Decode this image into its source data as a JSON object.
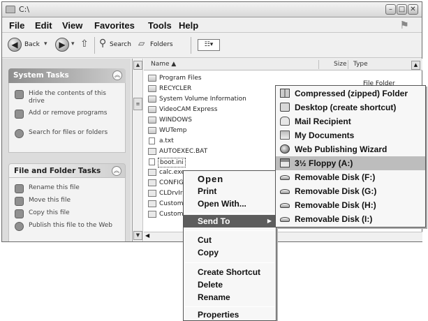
{
  "window": {
    "title": "C:\\",
    "minimize": "–",
    "maximize": "□",
    "close": "✕"
  },
  "menubar": [
    "File",
    "Edit",
    "View",
    "Favorites",
    "Tools",
    "Help"
  ],
  "toolbar": {
    "back": "Back",
    "search": "Search",
    "folders": "Folders",
    "views_glyph": "☷▾"
  },
  "tasks": {
    "system_title": "System Tasks",
    "system_items": [
      "Hide the contents of this drive",
      "Add or remove programs",
      "Search for files or folders"
    ],
    "file_title": "File and Folder Tasks",
    "file_items": [
      "Rename this file",
      "Move this file",
      "Copy this file",
      "Publish this file to the Web"
    ]
  },
  "columns": {
    "name": "Name ▲",
    "size": "Size",
    "type": "Type"
  },
  "files": [
    {
      "name": "Program Files",
      "kind": "folder"
    },
    {
      "name": "RECYCLER",
      "kind": "folder"
    },
    {
      "name": "System Volume Information",
      "kind": "folder"
    },
    {
      "name": "VideoCAM Express",
      "kind": "folder"
    },
    {
      "name": "WINDOWS",
      "kind": "folder"
    },
    {
      "name": "WUTemp",
      "kind": "folder"
    },
    {
      "name": "a.txt",
      "kind": "doc"
    },
    {
      "name": "AUTOEXEC.BAT",
      "kind": "file"
    },
    {
      "name": "boot.ini",
      "kind": "doc"
    },
    {
      "name": "calc.exe",
      "kind": "file"
    },
    {
      "name": "CONFIG",
      "kind": "file"
    },
    {
      "name": "CLDrvIre",
      "kind": "file"
    },
    {
      "name": "Custom I",
      "kind": "file"
    },
    {
      "name": "Custom I",
      "kind": "file"
    }
  ],
  "first_type": "File Folder",
  "context_menu": {
    "open": "Open",
    "print": "Print",
    "open_with": "Open With...",
    "send_to": "Send To",
    "cut": "Cut",
    "copy": "Copy",
    "create_shortcut": "Create Shortcut",
    "delete": "Delete",
    "rename": "Rename",
    "properties": "Properties"
  },
  "send_to": [
    {
      "label": "Compressed (zipped) Folder",
      "icon": "zip-folder-icon"
    },
    {
      "label": "Desktop (create shortcut)",
      "icon": "desktop-icon"
    },
    {
      "label": "Mail Recipient",
      "icon": "mail-icon"
    },
    {
      "label": "My Documents",
      "icon": "documents-icon"
    },
    {
      "label": "Web Publishing Wizard",
      "icon": "web-icon"
    },
    {
      "label": "3½ Floppy (A:)",
      "icon": "floppy-icon"
    },
    {
      "label": "Removable Disk (F:)",
      "icon": "disk-icon"
    },
    {
      "label": "Removable Disk (G:)",
      "icon": "disk-icon"
    },
    {
      "label": "Removable Disk (H:)",
      "icon": "disk-icon"
    },
    {
      "label": "Removable Disk (I:)",
      "icon": "disk-icon"
    }
  ]
}
